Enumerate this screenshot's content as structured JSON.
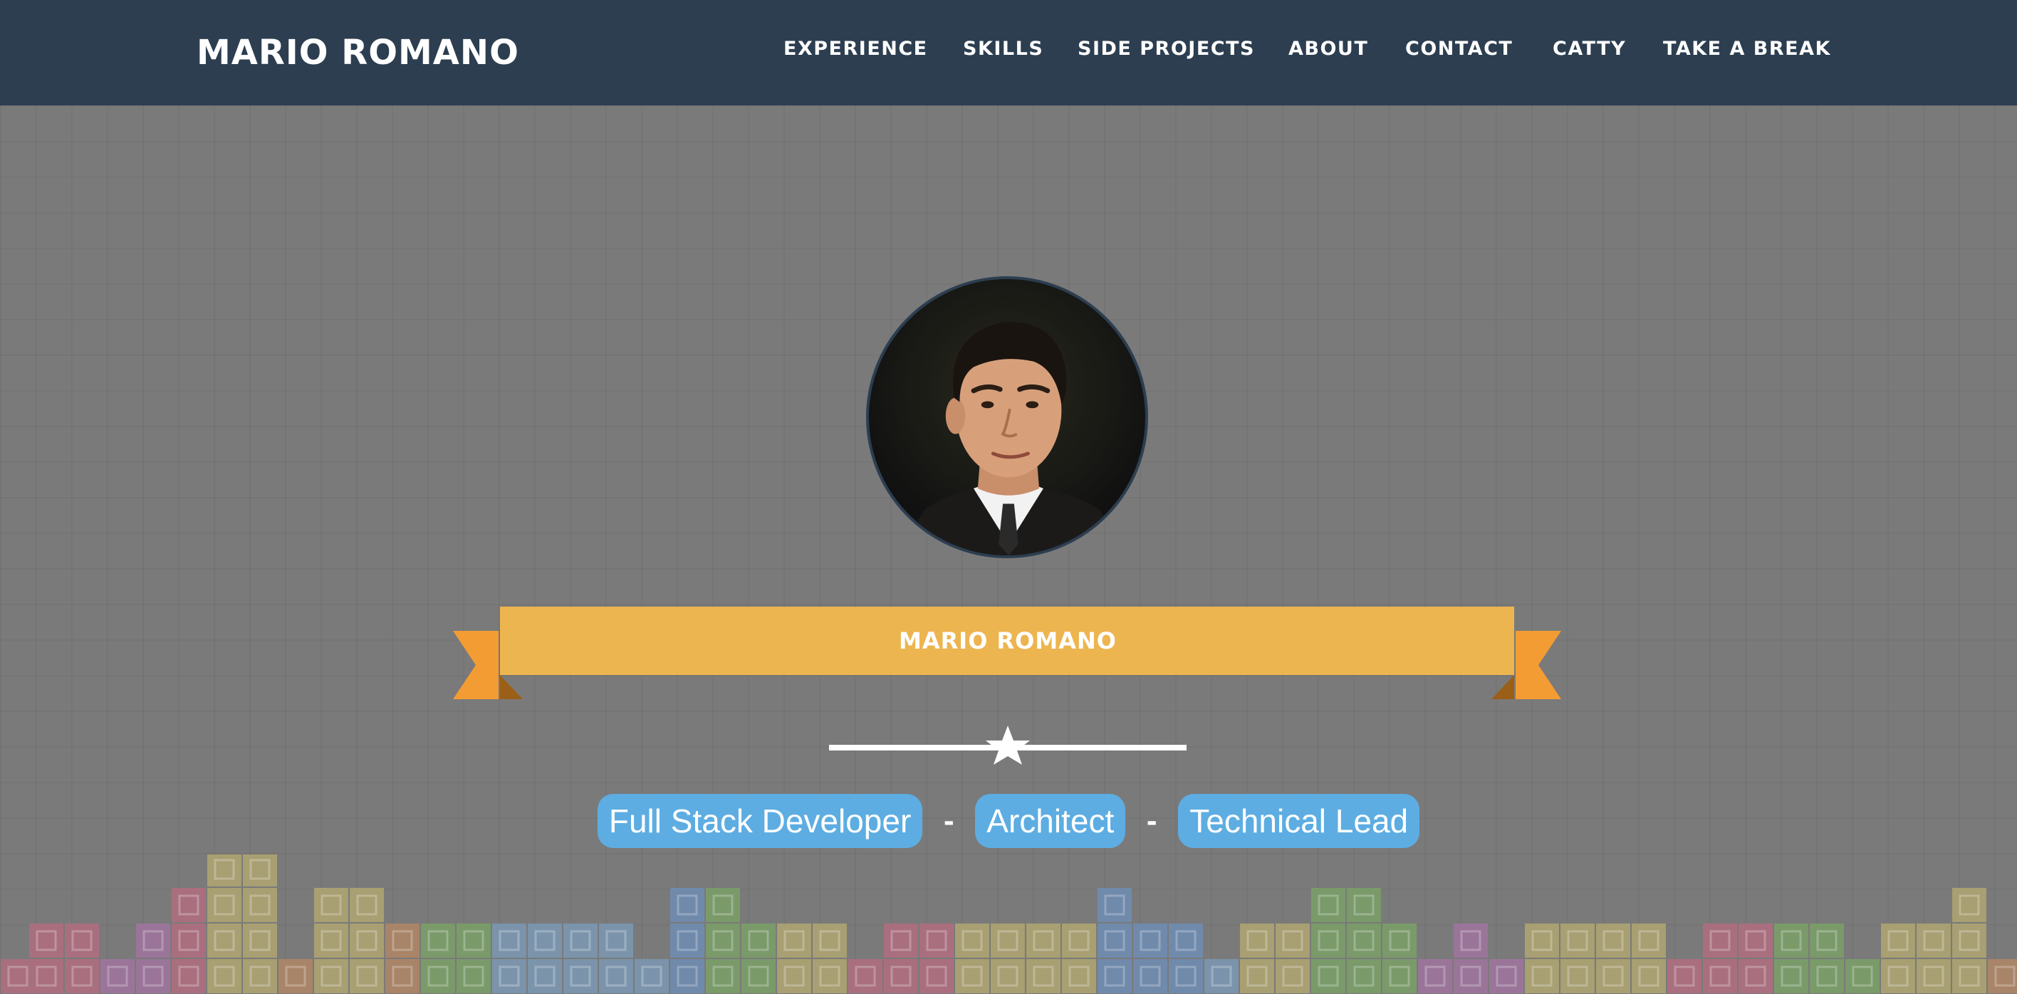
{
  "navbar": {
    "brand": "MARIO ROMANO",
    "items": [
      {
        "label": "EXPERIENCE"
      },
      {
        "label": "SKILLS"
      },
      {
        "label": "SIDE PROJECTS"
      },
      {
        "label": "ABOUT"
      },
      {
        "label": "CONTACT"
      },
      {
        "label": "CATTY"
      },
      {
        "label": "TAKE A BREAK"
      }
    ]
  },
  "hero": {
    "name": "MARIO ROMANO",
    "avatar_icon": "profile-photo",
    "divider_icon": "star-icon",
    "tags": [
      "Full Stack Developer",
      "Architect",
      "Technical Lead"
    ],
    "separator": "-"
  },
  "colors": {
    "navbar_bg": "#2c3e50",
    "page_bg": "#7a7a7a",
    "ribbon": "#edb54f",
    "ribbon_tail": "#f39c34",
    "tag_bg": "#5dade2"
  }
}
